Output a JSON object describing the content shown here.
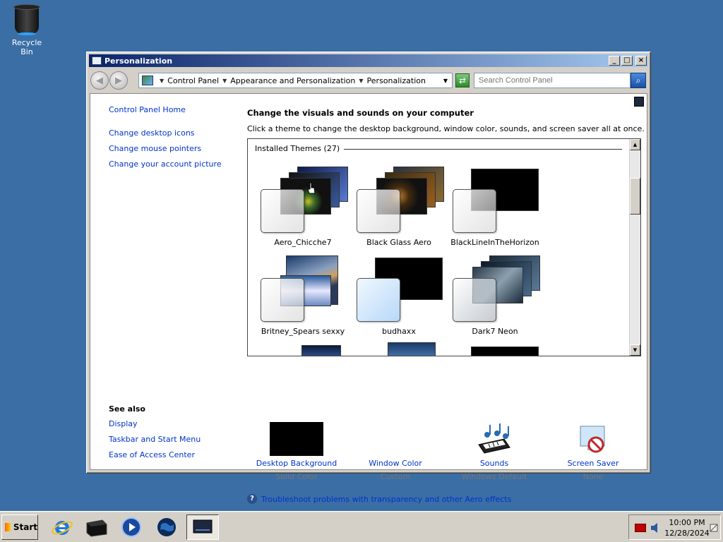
{
  "desktop": {
    "recycle_bin_label": "Recycle Bin"
  },
  "window": {
    "title": "Personalization",
    "controls": {
      "minimize": "_",
      "maximize": "□",
      "close": "×"
    }
  },
  "address_bar": {
    "crumbs": [
      "Control Panel",
      "Appearance and Personalization",
      "Personalization"
    ],
    "search_placeholder": "Search Control Panel"
  },
  "sidebar": {
    "home": "Control Panel Home",
    "links": [
      "Change desktop icons",
      "Change mouse pointers",
      "Change your account picture"
    ],
    "see_also_header": "See also",
    "see_also": [
      "Display",
      "Taskbar and Start Menu",
      "Ease of Access Center"
    ]
  },
  "main": {
    "heading": "Change the visuals and sounds on your computer",
    "description": "Click a theme to change the desktop background, window color, sounds, and screen saver all at once.",
    "themes_header": "Installed Themes (27)",
    "themes": [
      {
        "name": "Aero_Chicche7"
      },
      {
        "name": "Black Glass Aero"
      },
      {
        "name": "BlackLineInTheHorizon"
      },
      {
        "name": "Britney_Spears sexxy"
      },
      {
        "name": "budhaxx"
      },
      {
        "name": "Dark7 Neon"
      }
    ]
  },
  "settings": [
    {
      "name": "Desktop Background",
      "value": "Solid Color"
    },
    {
      "name": "Window Color",
      "value": "Custom"
    },
    {
      "name": "Sounds",
      "value": "Windows Default"
    },
    {
      "name": "Screen Saver",
      "value": "None"
    }
  ],
  "troubleshoot_link": "Troubleshoot problems with transparency and other Aero effects",
  "taskbar": {
    "start_label": "Start",
    "time": "10:00 PM",
    "date": "12/28/2024"
  },
  "colors": {
    "desktop": "#3a6ea5",
    "link": "#0033cc",
    "title_start": "#0a246a",
    "title_end": "#a6caf0"
  }
}
